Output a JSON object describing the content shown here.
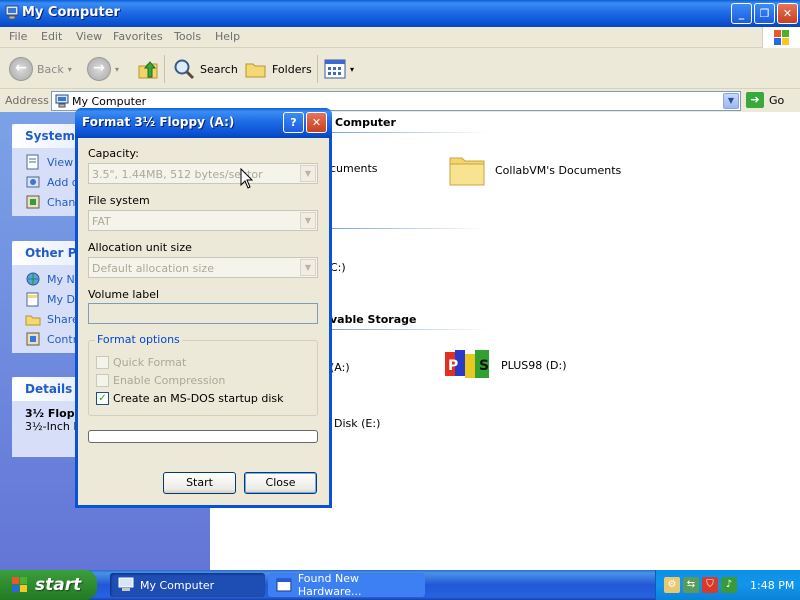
{
  "window": {
    "title": "My Computer"
  },
  "menu": [
    "File",
    "Edit",
    "View",
    "Favorites",
    "Tools",
    "Help"
  ],
  "toolbar": {
    "back_label": "Back",
    "search_label": "Search",
    "folders_label": "Folders"
  },
  "address": {
    "label": "Address",
    "value": "My Computer",
    "go_label": "Go"
  },
  "left_pane": {
    "system_tasks_header": "System Ta",
    "system_tasks": [
      "View s",
      "Add o",
      "Chang"
    ],
    "other_places_header": "Other Pla",
    "other_places": [
      "My Ne",
      "My Do",
      "Share",
      "Contr"
    ],
    "details_header": "Details",
    "details_name": "3½ Flopp",
    "details_type": "3½-Inch F"
  },
  "content": {
    "group1_header": "Computer",
    "item_shared_docs": "cuments",
    "item_collab_docs": "CollabVM's Documents",
    "item_c": "C:)",
    "group2_header": "vable Storage",
    "item_a": "(A:)",
    "item_plus98": "PLUS98 (D:)",
    "item_e": "Disk (E:)"
  },
  "dialog": {
    "title": "Format 3½ Floppy (A:)",
    "capacity_label": "Capacity:",
    "capacity_value": "3.5\",  1.44MB, 512 bytes/sector",
    "fs_label": "File system",
    "fs_value": "FAT",
    "alloc_label": "Allocation unit size",
    "alloc_value": "Default allocation size",
    "volume_label": "Volume label",
    "volume_value": "",
    "options_legend": "Format options",
    "opt_quick": "Quick Format",
    "opt_compress": "Enable Compression",
    "opt_msdos": "Create an MS-DOS startup disk",
    "start_label": "Start",
    "close_label": "Close"
  },
  "taskbar": {
    "start_label": "start",
    "task1": "My Computer",
    "task2": "Found New Hardware...",
    "clock": "1:48 PM"
  }
}
